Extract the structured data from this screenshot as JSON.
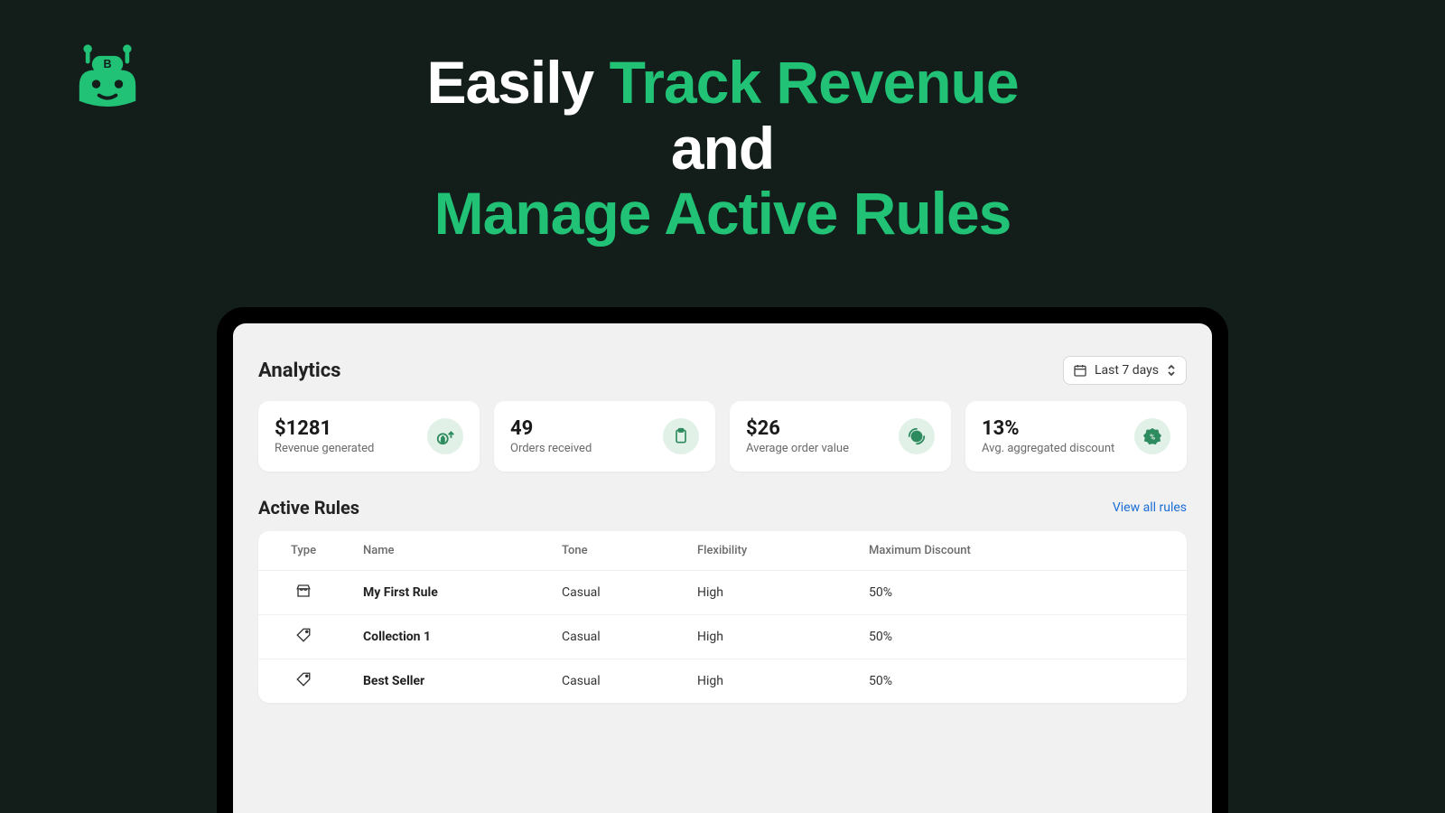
{
  "headline": {
    "part1": "Easily ",
    "part2": "Track Revenue",
    "part3": "and",
    "part4": "Manage Active Rules"
  },
  "analytics": {
    "title": "Analytics",
    "datePicker": "Last 7 days",
    "stats": [
      {
        "value": "$1281",
        "label": "Revenue generated",
        "icon": "money-up-icon"
      },
      {
        "value": "49",
        "label": "Orders received",
        "icon": "clipboard-icon"
      },
      {
        "value": "$26",
        "label": "Average order value",
        "icon": "dollar-circle-icon"
      },
      {
        "value": "13%",
        "label": "Avg. aggregated discount",
        "icon": "percent-badge-icon"
      }
    ]
  },
  "rules": {
    "title": "Active Rules",
    "viewAll": "View all rules",
    "columns": [
      "Type",
      "Name",
      "Tone",
      "Flexibility",
      "Maximum Discount"
    ],
    "rows": [
      {
        "type": "store",
        "name": "My First Rule",
        "tone": "Casual",
        "flexibility": "High",
        "maxDiscount": "50%"
      },
      {
        "type": "tag",
        "name": "Collection 1",
        "tone": "Casual",
        "flexibility": "High",
        "maxDiscount": "50%"
      },
      {
        "type": "tag",
        "name": "Best Seller",
        "tone": "Casual",
        "flexibility": "High",
        "maxDiscount": "50%"
      }
    ]
  }
}
